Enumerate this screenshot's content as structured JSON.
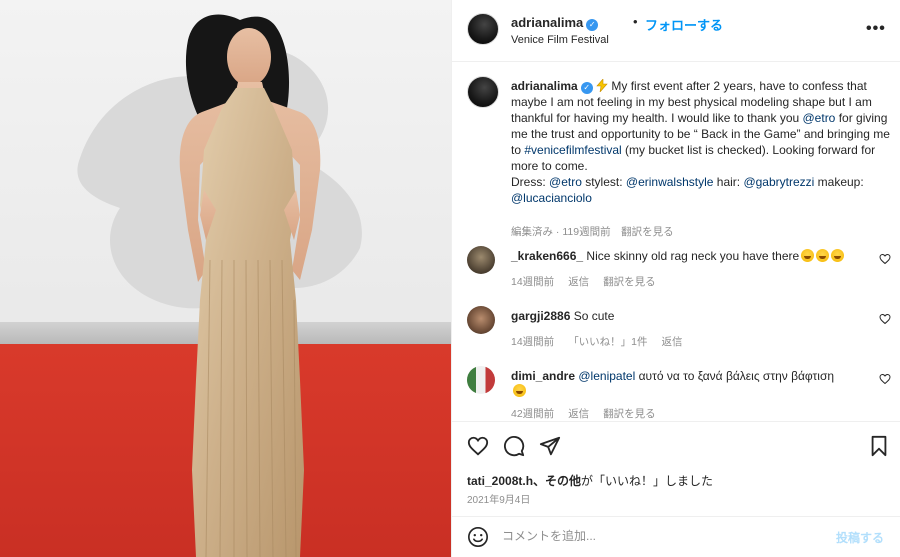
{
  "post": {
    "username": "adrianalima",
    "follow_label": "フォローする",
    "dot": "•",
    "location": "Venice Film Festival",
    "more_label": "•••"
  },
  "caption": {
    "username": "adrianalima",
    "part1": " My first event after 2 years, have to confess that maybe I am not feeling in my best physical modeling shape but I am thankful for having my health. I would like to thank you ",
    "mention_etro": "@etro",
    "part2": " for giving me the trust and opportunity to be “ Back in the Game” and bringing me to ",
    "hashtag": "#venicefilmfestival",
    "part3": " (my bucket list is checked). Looking forward for more to come.",
    "credits_dress": "Dress: ",
    "credits_stylist": " stylest: ",
    "mention_stylist": "@erinwalshstyle",
    "credits_hair": " hair: ",
    "mention_hair": "@gabrytrezzi",
    "credits_makeup": " makeup: ",
    "mention_makeup": "@lucacianciolo",
    "meta": "編集済み · 119週間前　翻訳を見る"
  },
  "comments": [
    {
      "username": "_kraken666_",
      "text": " Nice skinny old rag neck you have there",
      "time": "14週間前",
      "reply": "返信",
      "translate": "翻訳を見る",
      "likes": ""
    },
    {
      "username": "gargji2886",
      "text": " So cute",
      "time": "14週間前",
      "likes": "「いいね！」1件",
      "reply": "返信",
      "translate": ""
    },
    {
      "username": "dimi_andre",
      "mention": "@lenipatel",
      "text": " αυτό να το ξανά βάλεις στην βάφτιση",
      "time": "42週間前",
      "reply": "返信",
      "translate": "翻訳を見る",
      "likes": ""
    }
  ],
  "likes": {
    "user": "tati_2008t.h",
    "others": "、その他",
    "suffix": "が「いいね！」しました"
  },
  "date": "2021年9月4日",
  "add_comment": {
    "placeholder": "コメントを追加...",
    "post_label": "投稿する"
  },
  "colors": {
    "accent": "#0095f6",
    "link": "#00376b",
    "muted": "#8e8e8e",
    "carpet": "#d93a2b"
  }
}
